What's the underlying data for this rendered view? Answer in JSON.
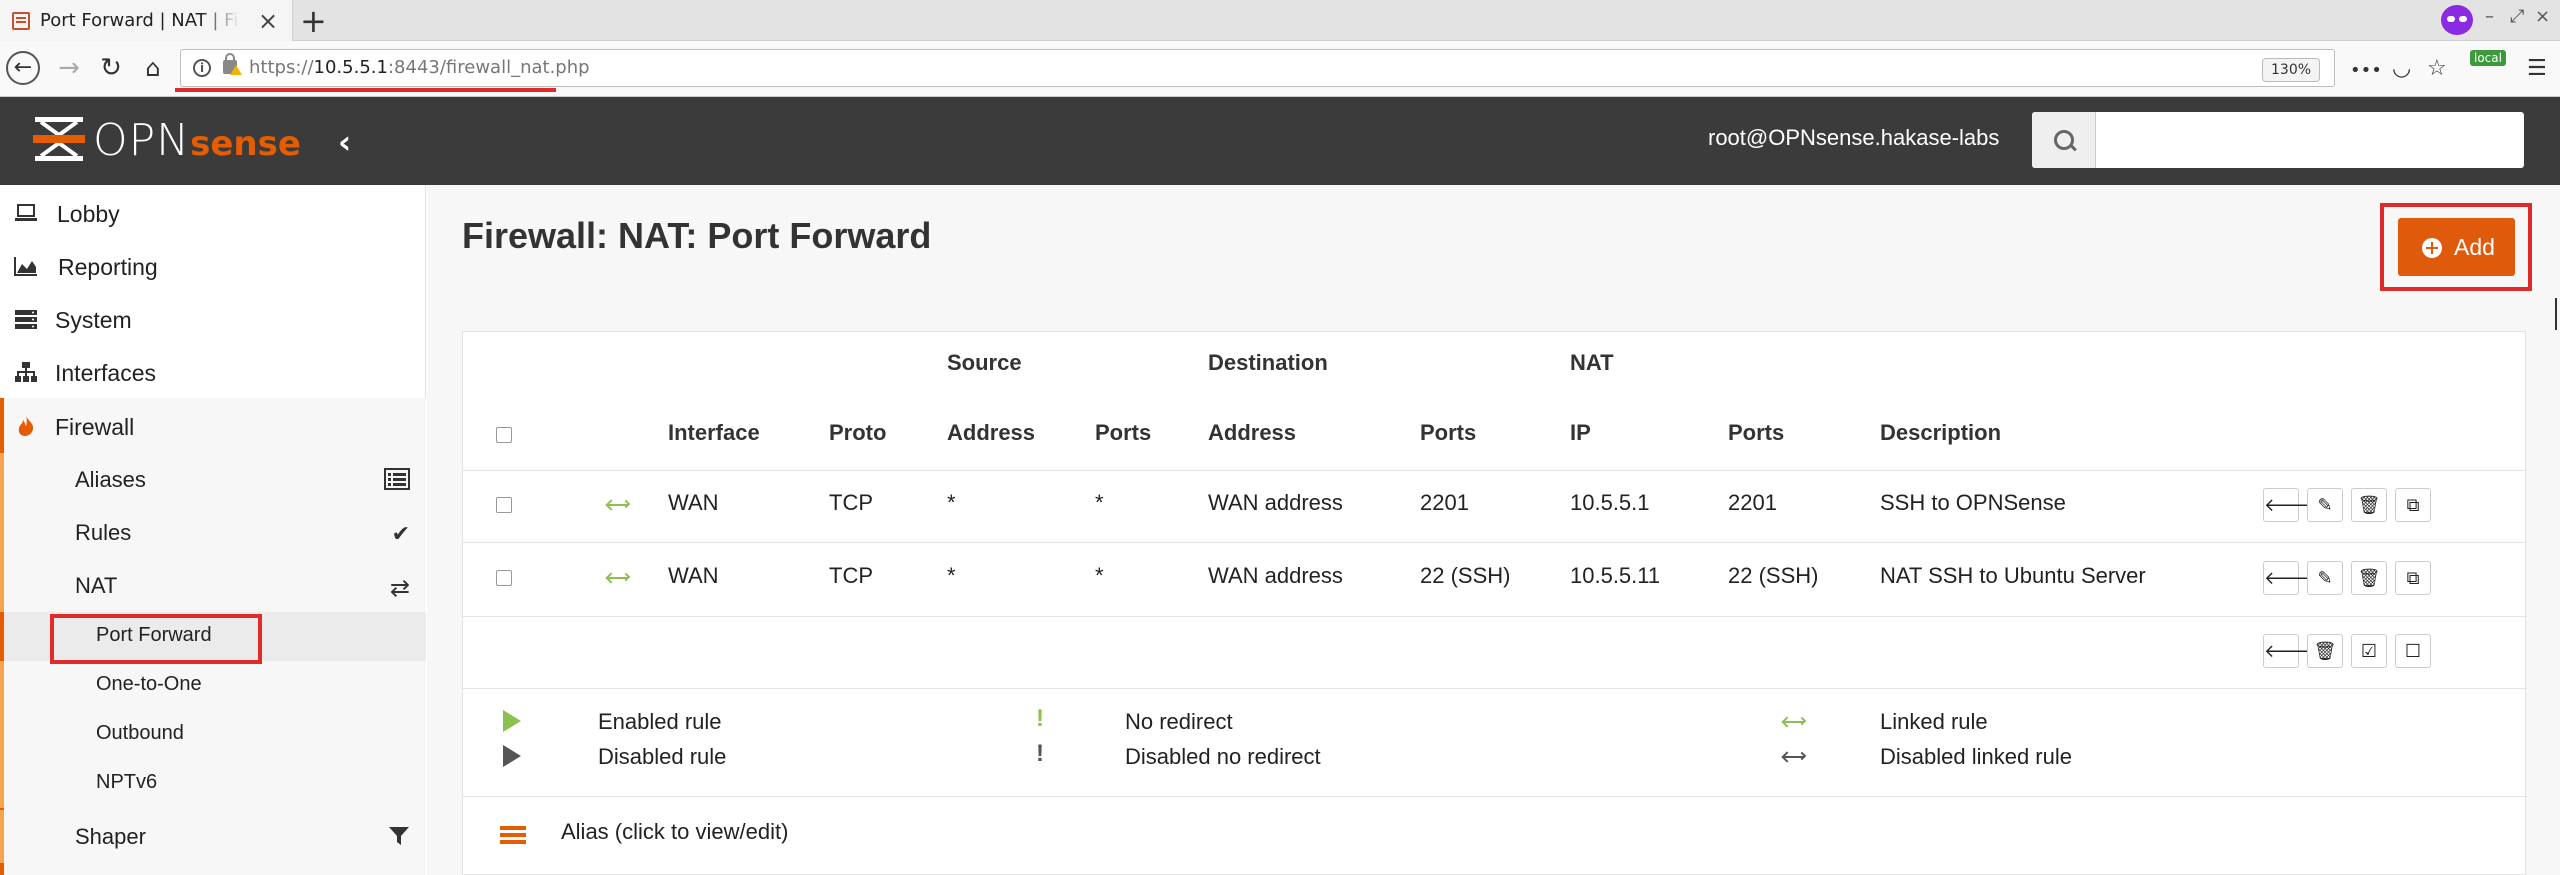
{
  "browser": {
    "tab_title": "Port Forward | NAT | Firewall",
    "new_tab": "+",
    "url_prefix": "https://",
    "url_host": "10.5.5.1",
    "url_path": ":8443/firewall_nat.php",
    "zoom": "130%",
    "local_badge": "local",
    "menu_dots": "•••"
  },
  "header": {
    "logo_opn": "OPN",
    "logo_sense": "sense",
    "user": "root@OPNsense.hakase-labs",
    "search_placeholder": ""
  },
  "sidebar": {
    "items": [
      {
        "label": "Lobby",
        "icon": "laptop-icon"
      },
      {
        "label": "Reporting",
        "icon": "area-chart-icon"
      },
      {
        "label": "System",
        "icon": "server-icon"
      },
      {
        "label": "Interfaces",
        "icon": "sitemap-icon"
      },
      {
        "label": "Firewall",
        "icon": "fire-icon"
      }
    ],
    "firewall_sub": [
      {
        "label": "Aliases",
        "icon": "list-icon"
      },
      {
        "label": "Rules",
        "icon": "check-icon"
      },
      {
        "label": "NAT",
        "icon": "exchange-icon"
      }
    ],
    "nat_sub": [
      "Port Forward",
      "One-to-One",
      "Outbound",
      "NPTv6"
    ],
    "shaper": {
      "label": "Shaper",
      "icon": "filter-icon"
    }
  },
  "main": {
    "title": "Firewall: NAT: Port Forward",
    "add_label": "Add",
    "group_headers": {
      "source": "Source",
      "destination": "Destination",
      "nat": "NAT"
    },
    "columns": [
      "Interface",
      "Proto",
      "Address",
      "Ports",
      "Address",
      "Ports",
      "IP",
      "Ports",
      "Description"
    ],
    "rows": [
      {
        "interface": "WAN",
        "proto": "TCP",
        "src_addr": "*",
        "src_ports": "*",
        "dst_addr": "WAN address",
        "dst_ports": "2201",
        "nat_ip": "10.5.5.1",
        "nat_ports": "2201",
        "description": "SSH to OPNSense"
      },
      {
        "interface": "WAN",
        "proto": "TCP",
        "src_addr": "*",
        "src_ports": "*",
        "dst_addr": "WAN address",
        "dst_ports": "22 (SSH)",
        "nat_ip": "10.5.5.11",
        "nat_ports": "22 (SSH)",
        "description": "NAT SSH to Ubuntu Server"
      }
    ],
    "legend": {
      "enabled": "Enabled rule",
      "disabled": "Disabled rule",
      "no_redirect": "No redirect",
      "disabled_no_redirect": "Disabled no redirect",
      "linked": "Linked rule",
      "disabled_linked": "Disabled linked rule",
      "alias": "Alias (click to view/edit)"
    }
  },
  "colors": {
    "accent": "#e65c00",
    "header_bg": "#3b3b3b",
    "enabled_green": "#8cc152",
    "highlight_red": "#e12b2b"
  }
}
